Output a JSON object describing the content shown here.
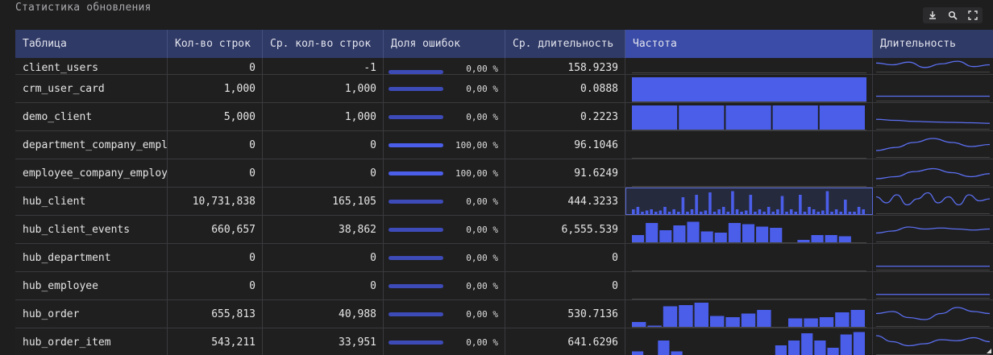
{
  "title": "Статистика обновления",
  "toolbar": {
    "icons": [
      "download-icon",
      "search-icon",
      "fullscreen-icon"
    ]
  },
  "colors": {
    "accent": "#4a5eea",
    "header": "#303a66",
    "header_selected": "#3b4ca8"
  },
  "columns": [
    "Таблица",
    "Кол-во строк",
    "Ср. кол-во строк",
    "Доля ошибок",
    "Ср. длительность",
    "Частота",
    "Длительность"
  ],
  "rows": [
    {
      "name": "client_users",
      "rows": "0",
      "avg": "-1",
      "err": "0,00 %",
      "err_frac": 0,
      "dur": "158.9239",
      "freq": [],
      "spark": [
        0.7,
        0.5,
        0.8,
        0.2,
        0.6,
        0.9,
        0.3,
        0.5
      ]
    },
    {
      "name": "crm_user_card",
      "rows": "1,000",
      "avg": "1,000",
      "err": "0,00 %",
      "err_frac": 0,
      "dur": "0.0888",
      "freq": [
        1
      ],
      "spark": [
        0.1,
        0.1,
        0.1,
        0.1,
        0.1,
        0.1
      ]
    },
    {
      "name": "demo_client",
      "rows": "5,000",
      "avg": "1,000",
      "err": "0,00 %",
      "err_frac": 0,
      "dur": "0.2223",
      "freq": [
        1,
        1,
        1,
        1,
        1
      ],
      "spark": [
        0.35,
        0.3,
        0.25,
        0.22,
        0.2,
        0.18,
        0.15
      ]
    },
    {
      "name": "department_company_employee",
      "rows": "0",
      "avg": "0",
      "err": "100,00 %",
      "err_frac": 1,
      "dur": "96.1046",
      "freq": [],
      "spark": [
        0.2,
        0.35,
        0.6,
        0.8,
        0.6,
        0.4,
        0.5
      ]
    },
    {
      "name": "employee_company_employee",
      "rows": "0",
      "avg": "0",
      "err": "100,00 %",
      "err_frac": 1,
      "dur": "91.6249",
      "freq": [],
      "spark": [
        0.2,
        0.3,
        0.55,
        0.7,
        0.5,
        0.3,
        0.45
      ]
    },
    {
      "name": "hub_client",
      "rows": "10,731,838",
      "avg": "165,105",
      "err": "0,00 %",
      "err_frac": 0,
      "dur": "444.3233",
      "freq": [
        0.2,
        0.3,
        0.1,
        0.15,
        0.2,
        0.1,
        0.15,
        0.3,
        0.1,
        0.2,
        0.1,
        0.7,
        0.1,
        0.2,
        0.8,
        0.1,
        0.15,
        0.9,
        0.1,
        0.2,
        0.3,
        0.1,
        0.95,
        0.2,
        0.1,
        0.15,
        0.8,
        0.1,
        0.2,
        0.1,
        0.3,
        0.1,
        0.2,
        0.75,
        0.1,
        0.2,
        0.1,
        0.8,
        0.1,
        0.3,
        0.2,
        0.1,
        0.15,
        0.95,
        0.1,
        0.2,
        0.1,
        0.6,
        0.1,
        0.1,
        0.3,
        0.2
      ],
      "spark": [
        0.7,
        0.4,
        0.8,
        0.3,
        0.6,
        0.9,
        0.4,
        0.7,
        0.3,
        0.8,
        0.5,
        0.6
      ]
    },
    {
      "name": "hub_client_events",
      "rows": "660,657",
      "avg": "38,862",
      "err": "0,00 %",
      "err_frac": 0,
      "dur": "6,555.539",
      "freq": [
        0.3,
        0.8,
        0.5,
        0.7,
        0.85,
        0.45,
        0.4,
        0.8,
        0.75,
        0.65,
        0.6,
        0,
        0.1,
        0.3,
        0.3,
        0.25,
        0
      ],
      "spark": [
        0.3,
        0.4,
        0.6,
        0.5,
        0.55,
        0.5,
        0.45,
        0.5
      ]
    },
    {
      "name": "hub_department",
      "rows": "0",
      "avg": "0",
      "err": "0,00 %",
      "err_frac": 0,
      "dur": "0",
      "freq": [],
      "spark": [
        0.05,
        0.05,
        0.05,
        0.05,
        0.05,
        0.05
      ]
    },
    {
      "name": "hub_employee",
      "rows": "0",
      "avg": "0",
      "err": "0,00 %",
      "err_frac": 0,
      "dur": "0",
      "freq": [],
      "spark": [
        0.05,
        0.05,
        0.05,
        0.05,
        0.05,
        0.05
      ]
    },
    {
      "name": "hub_order",
      "rows": "655,813",
      "avg": "40,988",
      "err": "0,00 %",
      "err_frac": 0,
      "dur": "530.7136",
      "freq": [
        0.2,
        0.05,
        0.85,
        0.9,
        1,
        0.45,
        0.4,
        0.55,
        0.7,
        0,
        0.35,
        0.35,
        0.4,
        0.6,
        0.7
      ],
      "spark": [
        0.5,
        0.6,
        0.3,
        0.2,
        0.5,
        0.8,
        0.6,
        0.5
      ]
    },
    {
      "name": "hub_order_item",
      "rows": "543,211",
      "avg": "33,951",
      "err": "0,00 %",
      "err_frac": 0,
      "dur": "641.6296",
      "freq": [
        0.15,
        0,
        0.6,
        0.15,
        0,
        0,
        0,
        0,
        0,
        0,
        0,
        0.4,
        0.6,
        0.9,
        0.6,
        0.3,
        0.85,
        0.95
      ],
      "spark": [
        0.8,
        0.5,
        0.3,
        0.4,
        0.6,
        0.55,
        0.7,
        0.5
      ]
    }
  ]
}
